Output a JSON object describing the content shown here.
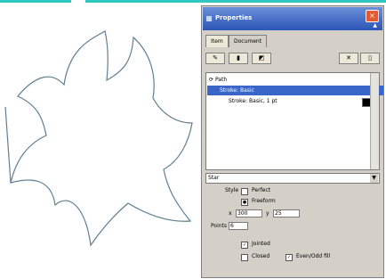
{
  "panel": {
    "title": "Properties",
    "close_glyph": "×",
    "collapse_glyph": "▲",
    "tabs": [
      "Item",
      "Document"
    ],
    "toolbar": {
      "buttons": [
        "pen-icon",
        "brush-icon",
        "eraser-icon",
        "delete-icon",
        "trash-icon"
      ]
    },
    "list": [
      {
        "label": "Path",
        "selected": false
      },
      {
        "label": "Stroke: Basic",
        "selected": true
      },
      {
        "label": "Stroke: Basic, 1 pt",
        "selected": false
      }
    ],
    "stroke_color": "#000000",
    "dropdown_value": "Star",
    "style": {
      "label": "Style",
      "options": [
        "Perfect",
        "Freeform"
      ],
      "checked_index": 1
    },
    "size": {
      "x_label": "x",
      "x_value": "300",
      "y_label": "y",
      "y_value": "25"
    },
    "points": {
      "label": "Points",
      "value": "6"
    },
    "checks": [
      {
        "label": "Jointed",
        "checked": true
      },
      {
        "label": "Closed",
        "checked": false
      },
      {
        "label": "Even/Odd fill",
        "checked": true
      }
    ]
  },
  "colors": {
    "accent": "#2fc7c0",
    "selection": "#3a66c9",
    "shape_stroke": "#5f7e93"
  }
}
